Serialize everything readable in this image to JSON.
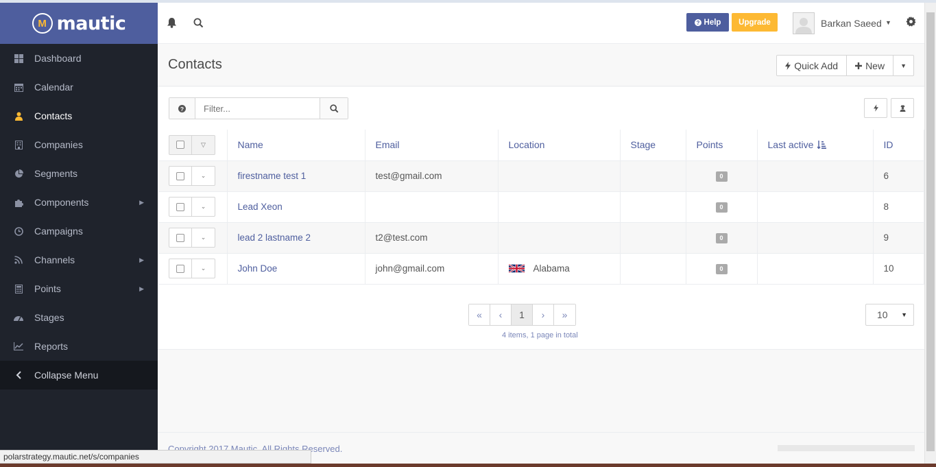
{
  "brand": {
    "name": "mautic",
    "mark": "M"
  },
  "sidebar": {
    "items": [
      {
        "label": "Dashboard",
        "icon": "th-large-icon"
      },
      {
        "label": "Calendar",
        "icon": "calendar-icon"
      },
      {
        "label": "Contacts",
        "icon": "user-icon",
        "active": true
      },
      {
        "label": "Companies",
        "icon": "building-icon"
      },
      {
        "label": "Segments",
        "icon": "pie-chart-icon"
      },
      {
        "label": "Components",
        "icon": "puzzle-icon",
        "submenu": true
      },
      {
        "label": "Campaigns",
        "icon": "clock-icon"
      },
      {
        "label": "Channels",
        "icon": "rss-icon",
        "submenu": true
      },
      {
        "label": "Points",
        "icon": "calculator-icon",
        "submenu": true
      },
      {
        "label": "Stages",
        "icon": "tachometer-icon"
      },
      {
        "label": "Reports",
        "icon": "line-chart-icon"
      }
    ],
    "collapse_label": "Collapse Menu"
  },
  "topbar": {
    "help_label": "Help",
    "upgrade_label": "Upgrade",
    "user_name": "Barkan Saeed"
  },
  "page": {
    "title": "Contacts",
    "quick_add_label": "Quick Add",
    "new_label": "New"
  },
  "filter": {
    "placeholder": "Filter..."
  },
  "table": {
    "headers": {
      "name": "Name",
      "email": "Email",
      "location": "Location",
      "stage": "Stage",
      "points": "Points",
      "last_active": "Last active",
      "id": "ID"
    },
    "rows": [
      {
        "name": "firestname test 1",
        "email": "test@gmail.com",
        "location": "",
        "stage": "",
        "points": "0",
        "last_active": "",
        "id": "6"
      },
      {
        "name": "Lead Xeon",
        "email": "",
        "location": "",
        "stage": "",
        "points": "0",
        "last_active": "",
        "id": "8"
      },
      {
        "name": "lead 2 lastname 2",
        "email": "t2@test.com",
        "location": "",
        "stage": "",
        "points": "0",
        "last_active": "",
        "id": "9"
      },
      {
        "name": "John Doe",
        "email": "john@gmail.com",
        "location": "Alabama",
        "stage": "",
        "points": "0",
        "last_active": "",
        "id": "10"
      }
    ]
  },
  "pagination": {
    "first": "«",
    "prev": "‹",
    "current": "1",
    "next": "›",
    "last": "»",
    "info": "4 items, 1 page in total",
    "per_page": "10"
  },
  "footer": {
    "copyright": "Copyright 2017 Mautic. All Rights Reserved."
  },
  "status_url": "polarstrategy.mautic.net/s/companies",
  "colors": {
    "brand": "#4e5e9e",
    "accent": "#fdb933",
    "sidebar": "#1f232c"
  }
}
